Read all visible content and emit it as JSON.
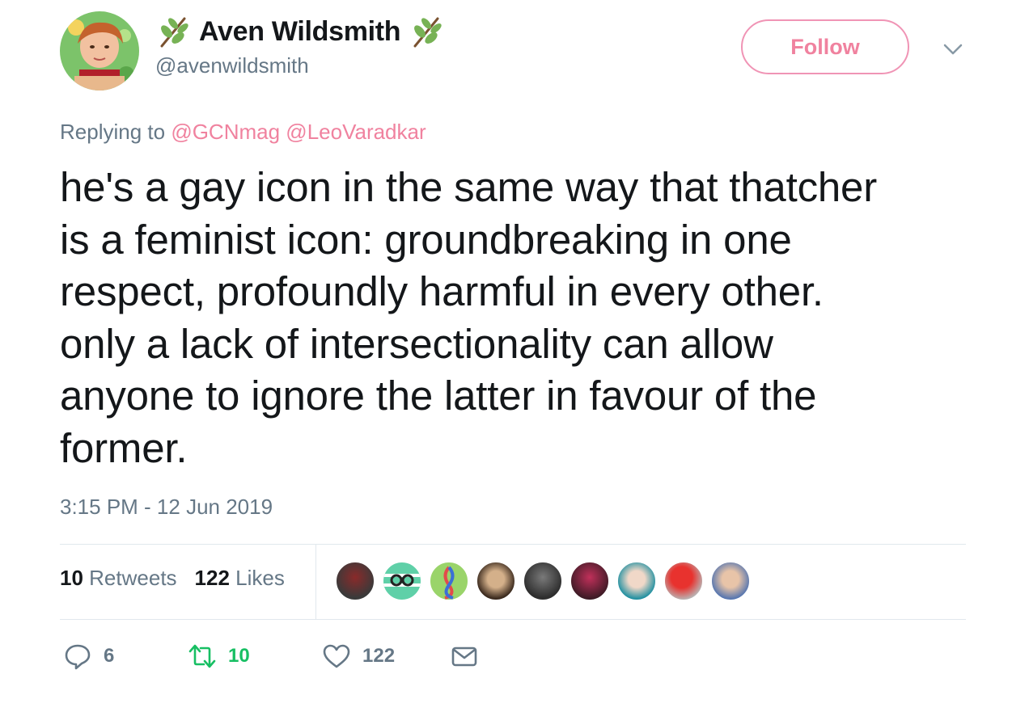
{
  "user": {
    "display_name": "Aven Wildsmith",
    "handle": "@avenwildsmith",
    "follow_label": "Follow"
  },
  "reply": {
    "prefix": "Replying to",
    "mentions": [
      "@GCNmag",
      "@LeoVaradkar"
    ]
  },
  "tweet": {
    "text": "he's a gay icon in the same way that thatcher\nis a feminist icon: groundbreaking in one\nrespect, profoundly harmful in every other.\nonly a lack of intersectionality can allow\nanyone to ignore the latter in favour of the\nformer.",
    "timestamp": "3:15 PM - 12 Jun 2019"
  },
  "stats": {
    "retweets_count": "10",
    "retweets_label": "Retweets",
    "likes_count": "122",
    "likes_label": "Likes"
  },
  "actions": {
    "reply_count": "6",
    "retweet_count": "10",
    "like_count": "122"
  },
  "colors": {
    "accent_pink": "#f0829f",
    "retweet_green": "#17bf63",
    "muted_text": "#657786",
    "divider": "#e1e8ed"
  },
  "icons": [
    "sprig-icon",
    "chevron-down-icon",
    "reply-icon",
    "retweet-icon",
    "heart-icon",
    "envelope-icon"
  ]
}
